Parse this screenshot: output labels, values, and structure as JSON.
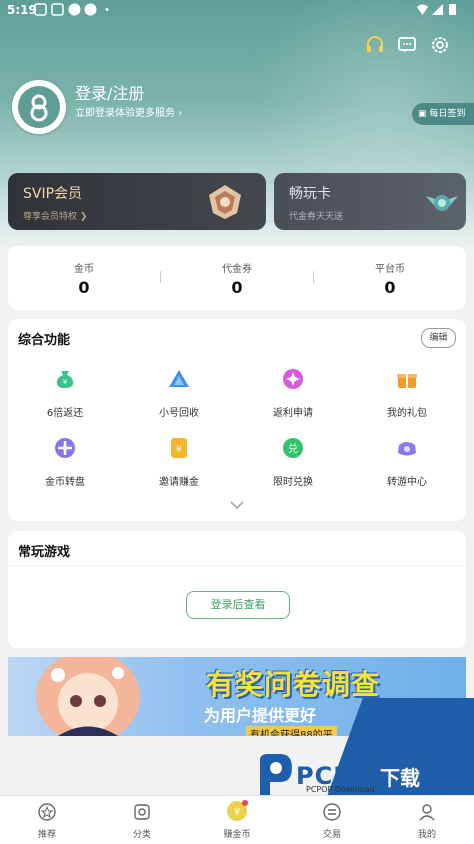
{
  "status": {
    "time": "5:19"
  },
  "profile": {
    "title": "登录/注册",
    "subtitle": "立即登录体验更多服务 ›",
    "checkin": "每日签到"
  },
  "vip": {
    "title": "SVIP会员",
    "subtitle": "尊享会员特权 ❯"
  },
  "playcard": {
    "title": "畅玩卡",
    "subtitle": "代金券天天送"
  },
  "stats": [
    {
      "label": "金币",
      "value": "0"
    },
    {
      "label": "代金券",
      "value": "0"
    },
    {
      "label": "平台币",
      "value": "0"
    }
  ],
  "features": {
    "title": "综合功能",
    "edit": "编辑",
    "items": [
      {
        "label": "6倍返还",
        "icon": "money-bag-icon",
        "color": "#3cc38a"
      },
      {
        "label": "小号回收",
        "icon": "triangle-icon",
        "color": "#3f8ef2"
      },
      {
        "label": "返利申请",
        "icon": "sparkle-icon",
        "color": "#d55bd8"
      },
      {
        "label": "我的礼包",
        "icon": "gift-icon",
        "color": "#f39a2d"
      },
      {
        "label": "金币转盘",
        "icon": "wheel-icon",
        "color": "#8b74e6"
      },
      {
        "label": "邀请赚金",
        "icon": "coin-card-icon",
        "color": "#f3b52b"
      },
      {
        "label": "限时兑换",
        "icon": "exchange-icon",
        "color": "#2fc46c"
      },
      {
        "label": "转游中心",
        "icon": "game-icon",
        "color": "#8c79e8"
      }
    ]
  },
  "recent": {
    "title": "常玩游戏",
    "login_button": "登录后查看"
  },
  "banner": {
    "title": "有奖问卷调查",
    "subtitle": "为用户提供更好",
    "note": "有机会获得88的平"
  },
  "watermark": {
    "brand": "PCPOP",
    "cn": "下载",
    "sub": "PCPOP Download"
  },
  "tabs": [
    {
      "label": "推荐",
      "icon": "star-icon"
    },
    {
      "label": "分类",
      "icon": "category-icon"
    },
    {
      "label": "赚金币",
      "icon": "coin-icon"
    },
    {
      "label": "交易",
      "icon": "trade-icon"
    },
    {
      "label": "我的",
      "icon": "profile-icon"
    }
  ],
  "colors": {
    "accent_green": "#5fb377",
    "header": "#5f9f98"
  }
}
